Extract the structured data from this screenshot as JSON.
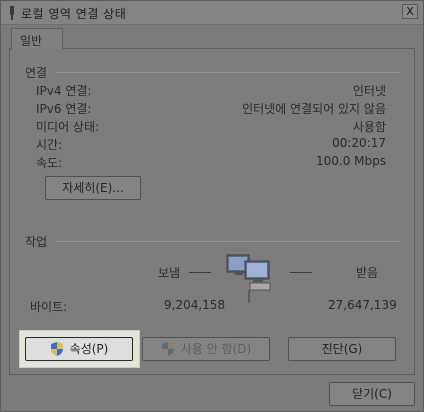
{
  "window": {
    "title": "로컬 영역 연결 상태",
    "close_label": "X"
  },
  "tabs": [
    {
      "label": "일반"
    }
  ],
  "connection": {
    "group_label": "연결",
    "rows": [
      {
        "label": "IPv4 연결:",
        "value": "인터넷"
      },
      {
        "label": "IPv6 연결:",
        "value": "인터넷에 연결되어 있지 않음"
      },
      {
        "label": "미디어 상태:",
        "value": "사용함"
      },
      {
        "label": "시간:",
        "value": "00:20:17"
      },
      {
        "label": "속도:",
        "value": "100.0 Mbps"
      }
    ],
    "details_label": "자세히(E)..."
  },
  "activity": {
    "group_label": "작업",
    "sent_label": "보냄",
    "received_label": "받음",
    "bytes_label": "바이트:",
    "sent_bytes": "9,204,158",
    "received_bytes": "27,647,139"
  },
  "buttons": {
    "properties": "속성(P)",
    "disable": "사용 안 함(D)",
    "diagnose": "진단(G)",
    "close": "닫기(C)"
  },
  "icons": {
    "title": "network-connection-icon",
    "shield": "uac-shield-icon",
    "activity": "network-computers-icon"
  }
}
